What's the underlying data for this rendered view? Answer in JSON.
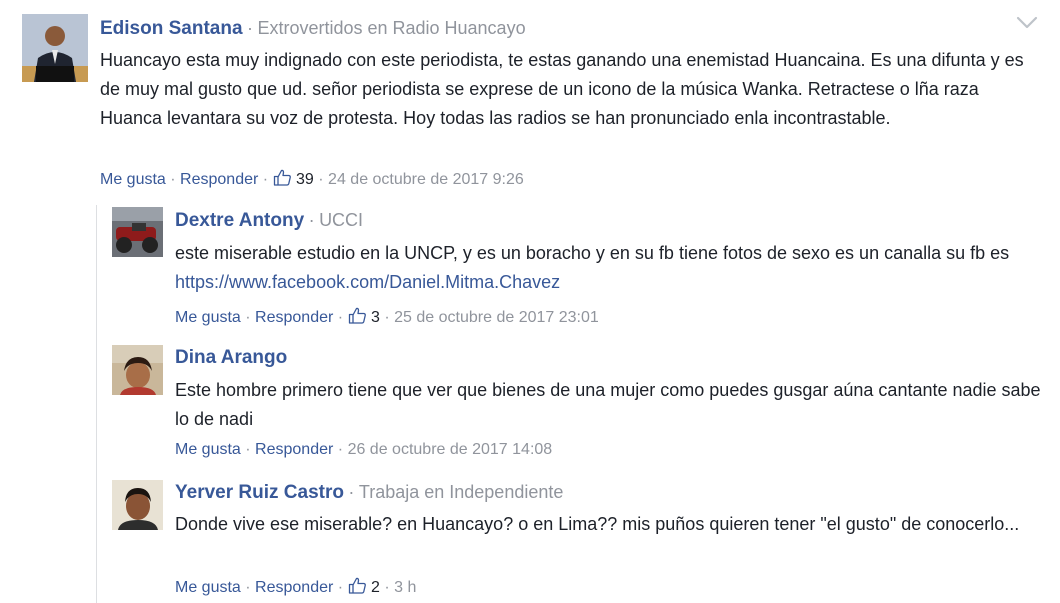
{
  "comments": [
    {
      "author": "Edison Santana",
      "affiliation": "Extrovertidos en Radio Huancayo",
      "text": "Huancayo esta muy indignado con este periodista, te estas ganando una enemistad Huancaina. Es una difunta y es de muy mal gusto que ud. señor periodista se exprese de un icono de la música Wanka. Retractese o lña raza Huanca levantara su voz de protesta. Hoy todas las radios se han pronunciado enla incontrastable.",
      "like_label": "Me gusta",
      "reply_label": "Responder",
      "like_count": "39",
      "timestamp": "24 de octubre de 2017 9:26"
    }
  ],
  "replies": [
    {
      "author": "Dextre Antony",
      "affiliation": "UCCI",
      "text": "este miserable estudio en la UNCP, y es un boracho y en su fb tiene fotos de sexo es un canalla su fb es ",
      "link": "https://www.facebook.com/Daniel.Mitma.Chavez",
      "like_label": "Me gusta",
      "reply_label": "Responder",
      "like_count": "3",
      "timestamp": "25 de octubre de 2017 23:01"
    },
    {
      "author": "Dina Arango",
      "text": "Este hombre primero tiene que ver que bienes de una mujer como puedes gusgar aúna cantante nadie sabe lo de nadi",
      "like_label": "Me gusta",
      "reply_label": "Responder",
      "timestamp": "26 de octubre de 2017 14:08"
    },
    {
      "author": "Yerver Ruiz Castro",
      "affiliation": "Trabaja en Independiente",
      "text": "Donde vive ese miserable? en Huancayo? o en Lima?? mis puños quieren tener \"el gusto\" de conocerlo...",
      "like_label": "Me gusta",
      "reply_label": "Responder",
      "like_count": "2",
      "timestamp": "3 h"
    }
  ],
  "ui": {
    "separator": "·",
    "link_color": "#385898",
    "meta_color": "#90949c",
    "options_icon": "chevron-down-icon",
    "like_icon": "thumbs-up-icon"
  }
}
